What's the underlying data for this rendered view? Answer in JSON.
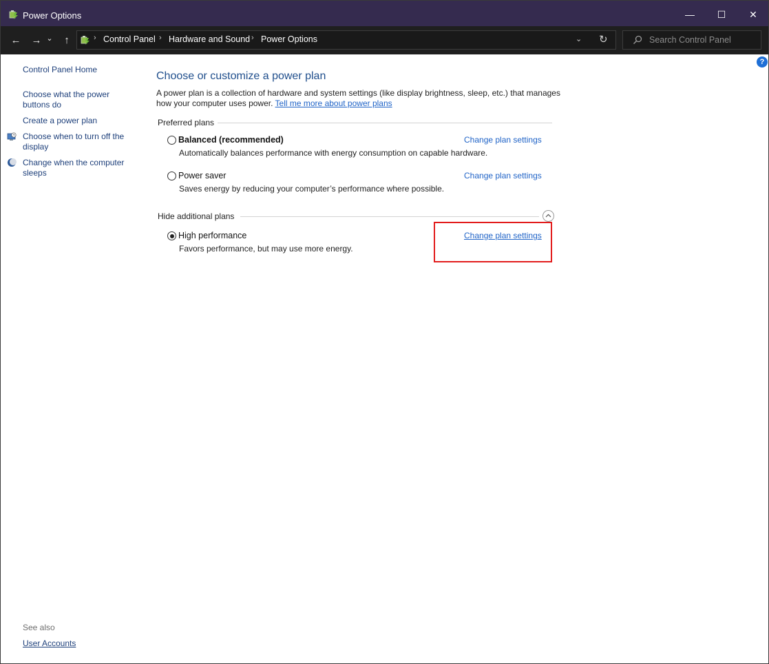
{
  "window": {
    "title": "Power Options",
    "minimize_glyph": "—",
    "maximize_glyph": "☐",
    "close_glyph": "✕"
  },
  "address_bar": {
    "back_glyph": "←",
    "forward_glyph": "→",
    "recent_glyph": "⌄",
    "up_glyph": "↑",
    "breadcrumbs": [
      "Control Panel",
      "Hardware and Sound",
      "Power Options"
    ],
    "separator": "›",
    "dropdown_glyph": "⌄",
    "refresh_glyph": "↻",
    "search_placeholder": "Search Control Panel"
  },
  "help_glyph": "?",
  "sidebar": {
    "home_link": "Control Panel Home",
    "links": [
      "Choose what the power buttons do",
      "Create a power plan",
      "Choose when to turn off the display",
      "Change when the computer sleeps"
    ],
    "see_also_label": "See also",
    "see_also_links": [
      "User Accounts"
    ]
  },
  "main": {
    "heading": "Choose or customize a power plan",
    "intro_text": "A power plan is a collection of hardware and system settings (like display brightness, sleep, etc.) that manages how your computer uses power.",
    "intro_link": "Tell me more about power plans",
    "preferred_label": "Preferred plans",
    "additional_label": "Hide additional plans",
    "plans": [
      {
        "name": "Balanced (recommended)",
        "description": "Automatically balances performance with energy consumption on capable hardware.",
        "link": "Change plan settings",
        "selected": false
      },
      {
        "name": "Power saver",
        "description": "Saves energy by reducing your computer’s performance where possible.",
        "link": "Change plan settings",
        "selected": false
      },
      {
        "name": "High performance",
        "description": "Favors performance, but may use more energy.",
        "link": "Change plan settings",
        "selected": true
      }
    ]
  },
  "colors": {
    "titlebar": "#352b4f",
    "link": "#1d3f7a",
    "heading": "#1f4e8c",
    "highlight": "#e21b1b"
  }
}
